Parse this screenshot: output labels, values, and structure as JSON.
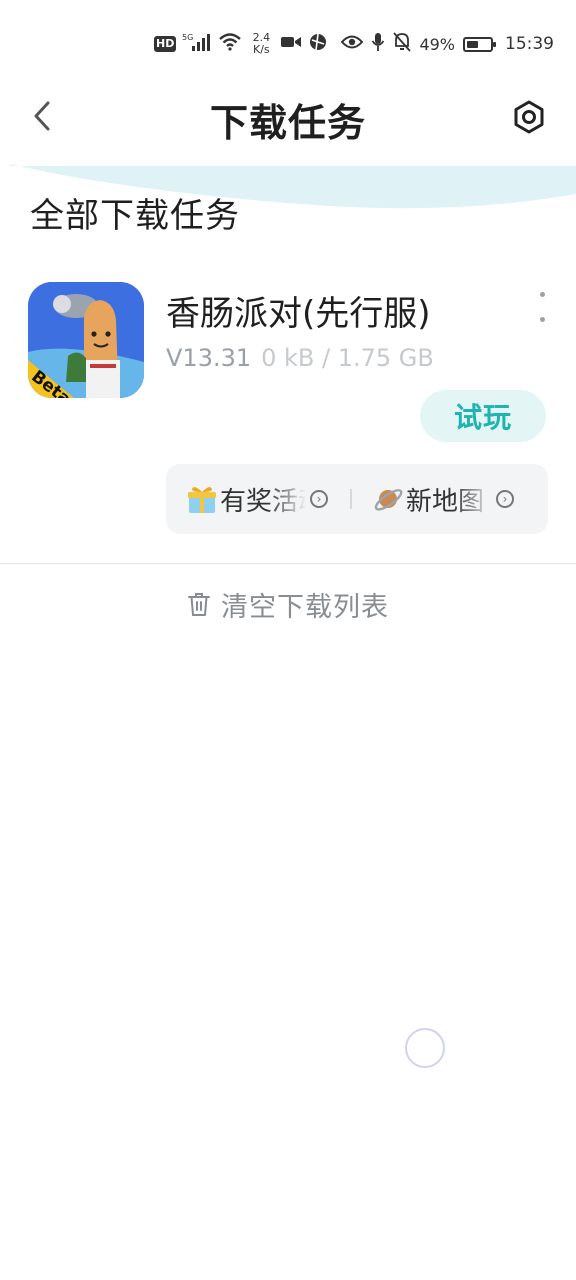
{
  "status_bar": {
    "hd": "HD",
    "net_type": "5G",
    "net_speed_value": "2.4",
    "net_speed_unit": "K/s",
    "battery_percent": "49%",
    "battery_level": 0.49,
    "time": "15:39"
  },
  "header": {
    "title": "下载任务",
    "back_icon": "chevron-left-icon",
    "settings_icon": "hexagon-settings-icon"
  },
  "section": {
    "title": "全部下载任务"
  },
  "download_item": {
    "name": "香肠派对(先行服)",
    "version": "V13.31",
    "size_progress": "0 kB / 1.75 GB",
    "action_label": "试玩",
    "icon_badge": "Beta",
    "tags": [
      {
        "label": "有奖活动",
        "icon": "gift-icon"
      },
      {
        "label": "新地图",
        "icon": "planet-icon"
      }
    ]
  },
  "footer": {
    "clear_label": "清空下载列表"
  },
  "colors": {
    "accent": "#1fb3b1",
    "accent_bg": "#e4f5f5",
    "wave": "#dff3f6"
  }
}
